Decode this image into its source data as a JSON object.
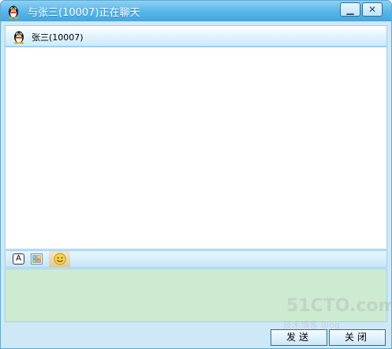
{
  "window": {
    "title": "与张三(10007)正在聊天",
    "minimize_label": "▁",
    "close_label": "✕"
  },
  "contact": {
    "name": "张三(10007)",
    "avatar_icon": "qq-penguin-icon"
  },
  "toolbar": {
    "font_label": "A",
    "icons": [
      "font-icon",
      "window-grid-icon",
      "emoji-icon"
    ]
  },
  "buttons": {
    "send": "发送",
    "close": "关闭"
  },
  "watermark": {
    "main": "51CTO.com",
    "sub": "技术博客 Blog"
  },
  "colors": {
    "title_bar": "#56b4e8",
    "input_bg": "#cdebd1",
    "frame_bg": "#cfe8f6"
  }
}
